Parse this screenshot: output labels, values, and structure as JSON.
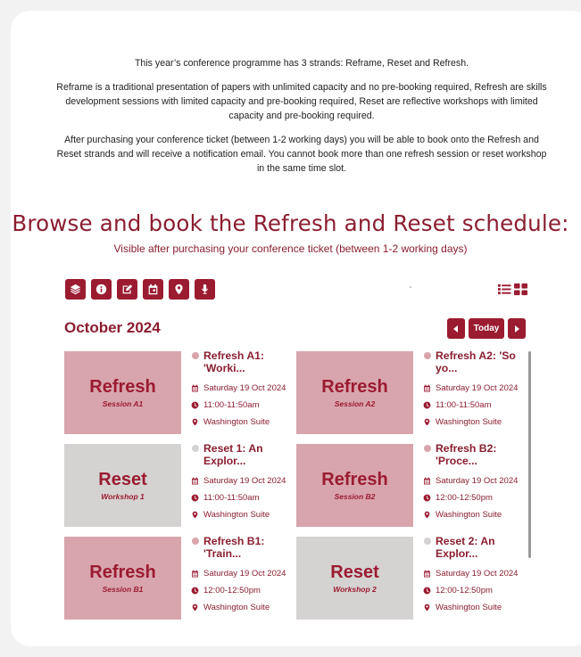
{
  "intro": {
    "p1": "This year’s conference programme has 3 strands: Reframe, Reset and Refresh.",
    "p2": "Reframe is a traditional presentation of papers with unlimited capacity and no pre-booking required, Refresh are skills development sessions with limited capacity and pre-booking required, Reset are reflective workshops with limited capacity and pre-booking required.",
    "p3": "After purchasing your conference ticket (between 1-2 working days) you will be able to book onto the Refresh and Reset strands and will receive a notification email. You cannot book more than one refresh session or reset workshop in the same time slot."
  },
  "browse": {
    "title": "Browse and book the Refresh and Reset schedule:",
    "subtitle": "Visible after purchasing your conference ticket (between 1-2 working days)"
  },
  "toolbar": {
    "icons": [
      "layers-icon",
      "info-icon",
      "edit-icon",
      "calendar-icon",
      "location-icon",
      "microphone-icon"
    ]
  },
  "calendar": {
    "month": "October 2024",
    "today_label": "Today"
  },
  "events": [
    {
      "thumb_title": "Refresh",
      "thumb_sub": "Session A1",
      "title": "Refresh A1: 'Worki...",
      "date": "Saturday 19 Oct 2024",
      "time": "11:00-11:50am",
      "location": "Washington Suite",
      "kind": "refresh"
    },
    {
      "thumb_title": "Refresh",
      "thumb_sub": "Session A2",
      "title": "Refresh A2: 'So yo...",
      "date": "Saturday 19 Oct 2024",
      "time": "11:00-11:50am",
      "location": "Washington Suite",
      "kind": "refresh"
    },
    {
      "thumb_title": "Reset",
      "thumb_sub": "Workshop 1",
      "title": "Reset 1: An Explor...",
      "date": "Saturday 19 Oct 2024",
      "time": "11:00-11:50am",
      "location": "Washington Suite",
      "kind": "reset"
    },
    {
      "thumb_title": "Refresh",
      "thumb_sub": "Session B2",
      "title": "Refresh B2: 'Proce...",
      "date": "Saturday 19 Oct 2024",
      "time": "12:00-12:50pm",
      "location": "Washington Suite",
      "kind": "refresh"
    },
    {
      "thumb_title": "Refresh",
      "thumb_sub": "Session B1",
      "title": "Refresh B1: 'Train...",
      "date": "Saturday 19 Oct 2024",
      "time": "12:00-12:50pm",
      "location": "Washington Suite",
      "kind": "refresh"
    },
    {
      "thumb_title": "Reset",
      "thumb_sub": "Workshop 2",
      "title": "Reset 2: An Explor...",
      "date": "Saturday 19 Oct 2024",
      "time": "12:00-12:50pm",
      "location": "Washington Suite",
      "kind": "reset"
    }
  ],
  "colors": {
    "accent": "#9b1b30",
    "refresh_bg": "#d9a5ad",
    "reset_bg": "#d5d2d2"
  }
}
